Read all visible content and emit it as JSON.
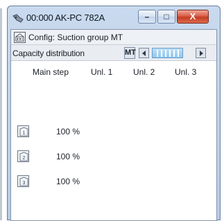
{
  "window": {
    "title": "00:000 AK-PC 782A",
    "minimize_glyph": "–",
    "maximize_glyph": "□",
    "close_glyph": "X"
  },
  "config": {
    "title": "Config: Suction group MT"
  },
  "capacity": {
    "title": "Capacity distribution",
    "tab_label": "MT",
    "nav_prev_icon": "arrow-left-icon",
    "nav_next_icon": "arrow-right-icon"
  },
  "table": {
    "headers": [
      "Main step",
      "Unl. 1",
      "Unl. 2",
      "Unl. 3"
    ],
    "rows": [
      {
        "step": "1",
        "value": "100 %"
      },
      {
        "step": "2",
        "value": "100 %"
      },
      {
        "step": "3",
        "value": "100 %"
      }
    ]
  },
  "colors": {
    "window_frame": "#b7cce6",
    "close_button": "#c43c22",
    "scroll_highlight": "#8ec6ee"
  }
}
